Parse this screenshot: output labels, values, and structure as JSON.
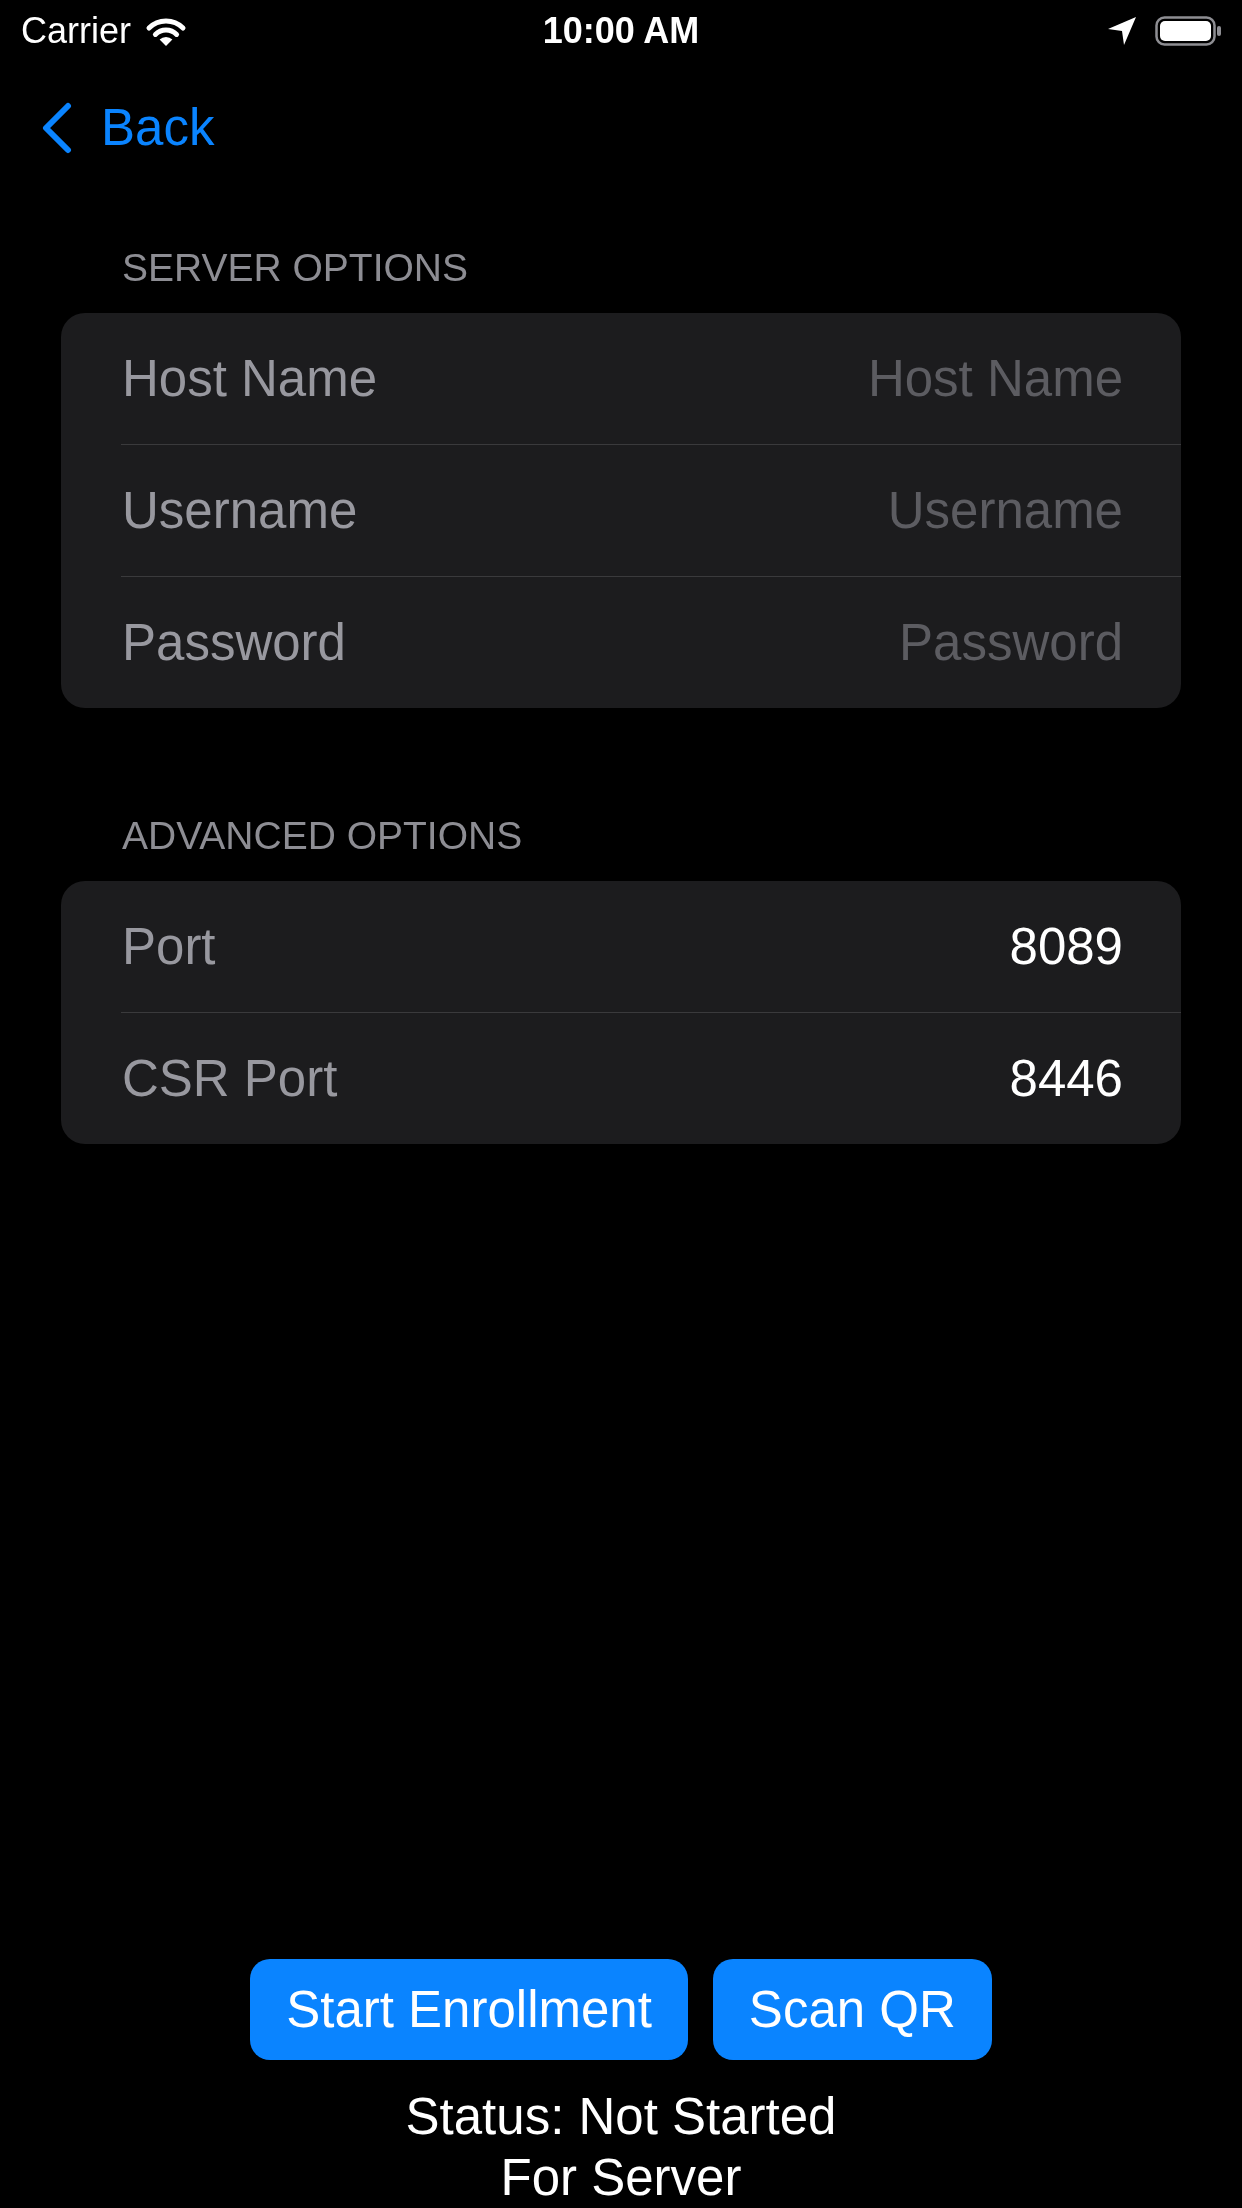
{
  "status_bar": {
    "carrier": "Carrier",
    "time": "10:00 AM"
  },
  "nav_bar": {
    "back": "Back"
  },
  "sections": [
    {
      "header": "SERVER OPTIONS",
      "rows": [
        {
          "label": "Host Name",
          "placeholder": "Host Name"
        },
        {
          "label": "Username",
          "placeholder": "Username"
        },
        {
          "label": "Password",
          "placeholder": "Password"
        }
      ]
    },
    {
      "header": "ADVANCED OPTIONS",
      "rows": [
        {
          "label": "Port",
          "value": "8089"
        },
        {
          "label": "CSR Port",
          "value": "8446"
        }
      ]
    }
  ],
  "buttons": [
    "Start Enrollment",
    "Scan QR"
  ],
  "status": "Status: Not Started For Server"
}
